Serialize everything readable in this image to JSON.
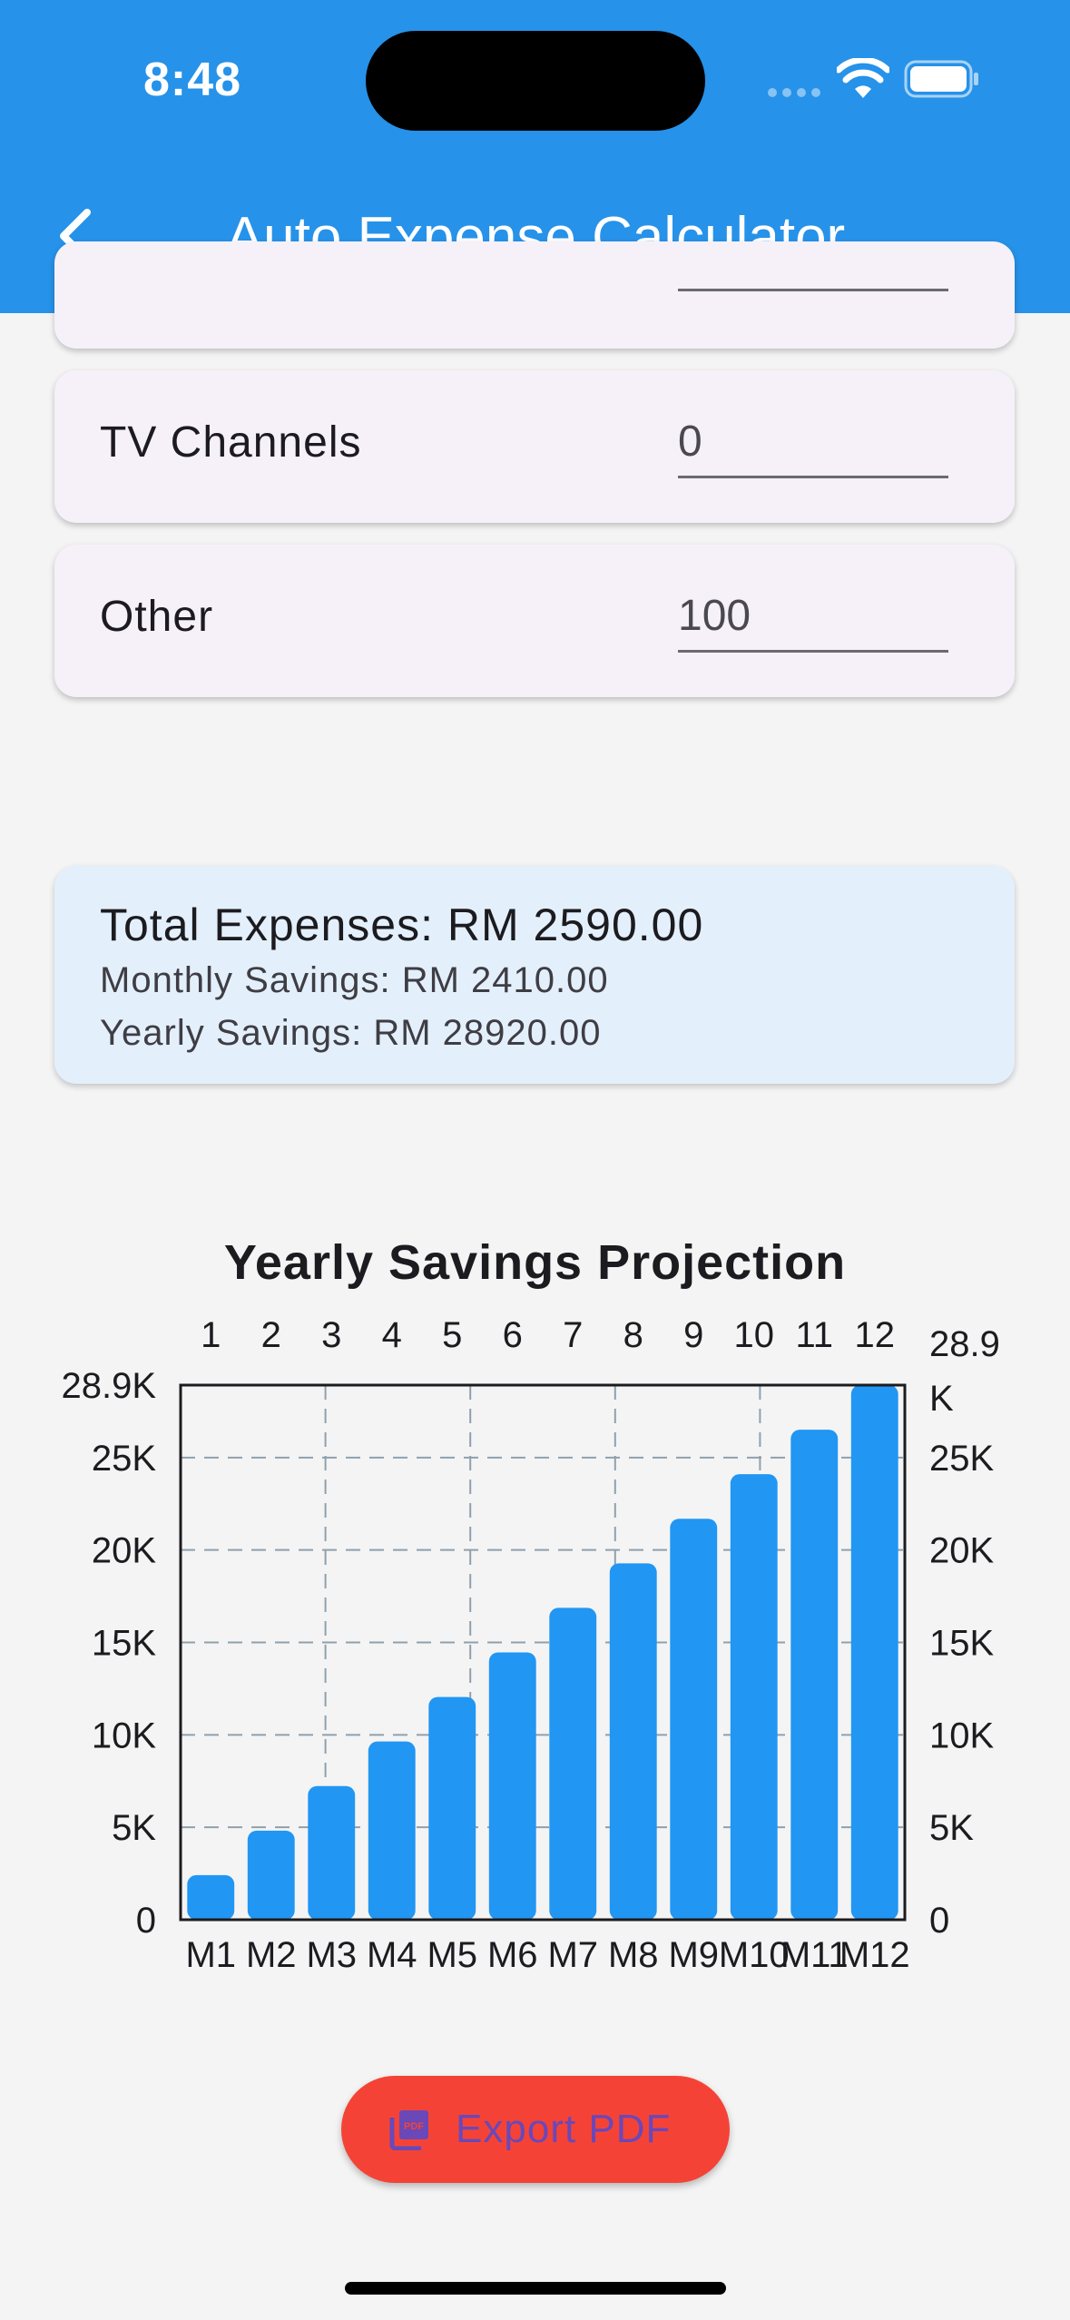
{
  "status_bar": {
    "time": "8:48"
  },
  "app_bar": {
    "title": "Auto Expense Calculator"
  },
  "expense_fields": [
    {
      "label": "",
      "value": ""
    },
    {
      "label": "TV Channels",
      "value": "0"
    },
    {
      "label": "Other",
      "value": "100"
    }
  ],
  "summary": {
    "total": "Total Expenses: RM 2590.00",
    "monthly": "Monthly Savings: RM 2410.00",
    "yearly": "Yearly Savings: RM 28920.00"
  },
  "chart_title": "Yearly Savings Projection",
  "chart_data": {
    "type": "bar",
    "title": "Yearly Savings Projection",
    "categories": [
      "M1",
      "M2",
      "M3",
      "M4",
      "M5",
      "M6",
      "M7",
      "M8",
      "M9",
      "M10",
      "M11",
      "M12"
    ],
    "top_labels": [
      "1",
      "2",
      "3",
      "4",
      "5",
      "6",
      "7",
      "8",
      "9",
      "10",
      "11",
      "12"
    ],
    "values": [
      2410,
      4820,
      7230,
      9640,
      12050,
      14460,
      16870,
      19280,
      21690,
      24100,
      26510,
      28920
    ],
    "yticks": [
      "0",
      "5K",
      "10K",
      "15K",
      "20K",
      "25K",
      "28.9K"
    ],
    "ytick_values": [
      0,
      5000,
      10000,
      15000,
      20000,
      25000,
      28920
    ],
    "right_yticks": [
      "0",
      "5K",
      "10K",
      "15K",
      "20K",
      "25K"
    ],
    "right_max_label": [
      "28.9",
      "K"
    ],
    "ylim": [
      0,
      28920
    ],
    "grid": true,
    "bar_color": "#2196f3"
  },
  "export_button": {
    "label": "Export PDF",
    "icon": "picture-as-pdf-icon",
    "background": "#f44336"
  },
  "colors": {
    "app_bar": "#2692e9",
    "card_bg": "#f6f1f8",
    "summary_bg": "#e3f0fc"
  }
}
